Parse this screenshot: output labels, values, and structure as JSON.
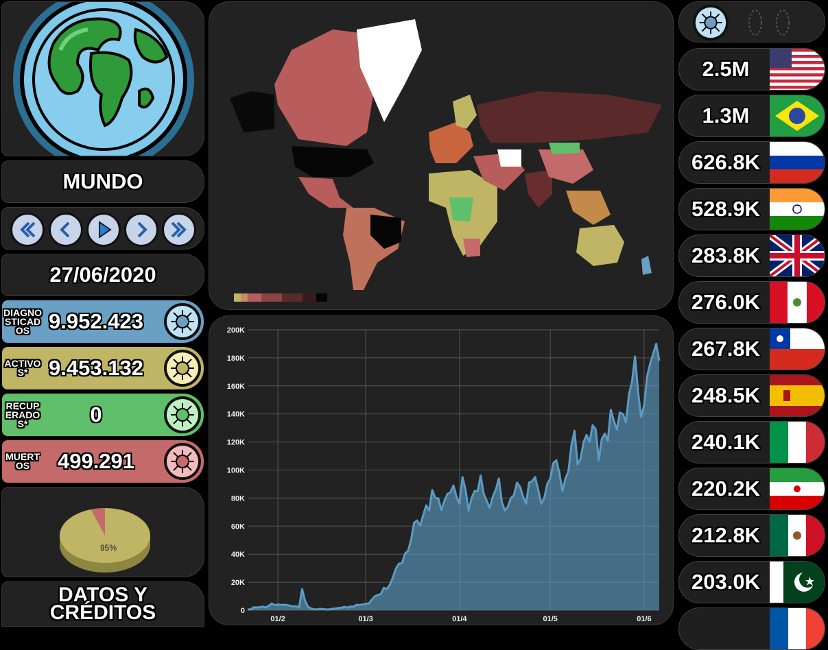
{
  "region_title": "MUNDO",
  "date": "27/06/2020",
  "stats": {
    "diagnosticados": {
      "label": "DIAGNOSTICADOS",
      "value": "9.952.423",
      "color": "#6aa0c4"
    },
    "activos": {
      "label": "ACTIVOS*",
      "value": "9.453.132",
      "color": "#bfb564"
    },
    "recuperados": {
      "label": "RECUPERADOS*",
      "value": "0",
      "color": "#5fbf6a"
    },
    "muertos": {
      "label": "MUERTOS",
      "value": "499.291",
      "color": "#c46a6a"
    }
  },
  "pie": {
    "label": "95%",
    "active_fraction": 0.95,
    "active_color": "#bfb564",
    "deaths_color": "#c46a6a"
  },
  "credits_label": "DATOS Y CRÉDITOS",
  "countries": [
    {
      "value": "2.5M",
      "flag": "usa-flag"
    },
    {
      "value": "1.3M",
      "flag": "brazil-flag"
    },
    {
      "value": "626.8K",
      "flag": "russia-flag"
    },
    {
      "value": "528.9K",
      "flag": "india-flag"
    },
    {
      "value": "283.8K",
      "flag": "uk-flag"
    },
    {
      "value": "276.0K",
      "flag": "peru-flag"
    },
    {
      "value": "267.8K",
      "flag": "chile-flag"
    },
    {
      "value": "248.5K",
      "flag": "spain-flag"
    },
    {
      "value": "240.1K",
      "flag": "italy-flag"
    },
    {
      "value": "220.2K",
      "flag": "iran-flag"
    },
    {
      "value": "212.8K",
      "flag": "mexico-flag"
    },
    {
      "value": "203.0K",
      "flag": "pakistan-flag"
    }
  ],
  "nav_buttons": [
    "first-icon",
    "previous-icon",
    "play-icon",
    "next-icon",
    "last-icon"
  ],
  "chart_data": {
    "type": "area",
    "title": "",
    "xlabel": "",
    "ylabel": "",
    "x_tick_labels": [
      "01/2",
      "01/3",
      "01/4",
      "01/5",
      "01/6"
    ],
    "y_tick_labels": [
      "0",
      "20K",
      "40K",
      "60K",
      "80K",
      "100K",
      "120K",
      "140K",
      "160K",
      "180K",
      "200K"
    ],
    "ylim": [
      0,
      200000
    ],
    "x_start": "22/01/2020",
    "x_end": "27/06/2020",
    "grid": true,
    "color": "#5b9bc3",
    "values": [
      560,
      640,
      2100,
      1980,
      2130,
      2600,
      2020,
      3200,
      4800,
      3600,
      4100,
      3800,
      3900,
      3700,
      3200,
      2700,
      2900,
      2000,
      15100,
      6500,
      2300,
      1200,
      600,
      600,
      1000,
      800,
      500,
      600,
      1000,
      1200,
      1600,
      1800,
      2400,
      1900,
      2700,
      2500,
      3900,
      3700,
      4100,
      4600,
      4800,
      7500,
      9900,
      10900,
      11500,
      16000,
      15000,
      18400,
      23500,
      29800,
      33200,
      33500,
      40400,
      42300,
      50000,
      62400,
      64000,
      60400,
      67800,
      74700,
      71200,
      85700,
      80000,
      79800,
      71500,
      78000,
      83000,
      84000,
      89000,
      81000,
      76000,
      95000,
      86000,
      71000,
      80000,
      85000,
      85000,
      96000,
      83000,
      78000,
      73000,
      81000,
      86000,
      94000,
      77000,
      71000,
      74000,
      80000,
      82000,
      91000,
      88000,
      81000,
      76000,
      91000,
      92000,
      95000,
      86000,
      76000,
      80000,
      90000,
      94000,
      105000,
      107000,
      98000,
      85000,
      94000,
      99000,
      118000,
      128000,
      104000,
      108000,
      120000,
      125000,
      120000,
      132000,
      129000,
      107000,
      122000,
      126000,
      121000,
      143000,
      135000,
      129000,
      141000,
      140000,
      134000,
      154000,
      163000,
      181000,
      156000,
      138000,
      146000,
      167000,
      176000,
      183000,
      190000,
      178000
    ]
  }
}
